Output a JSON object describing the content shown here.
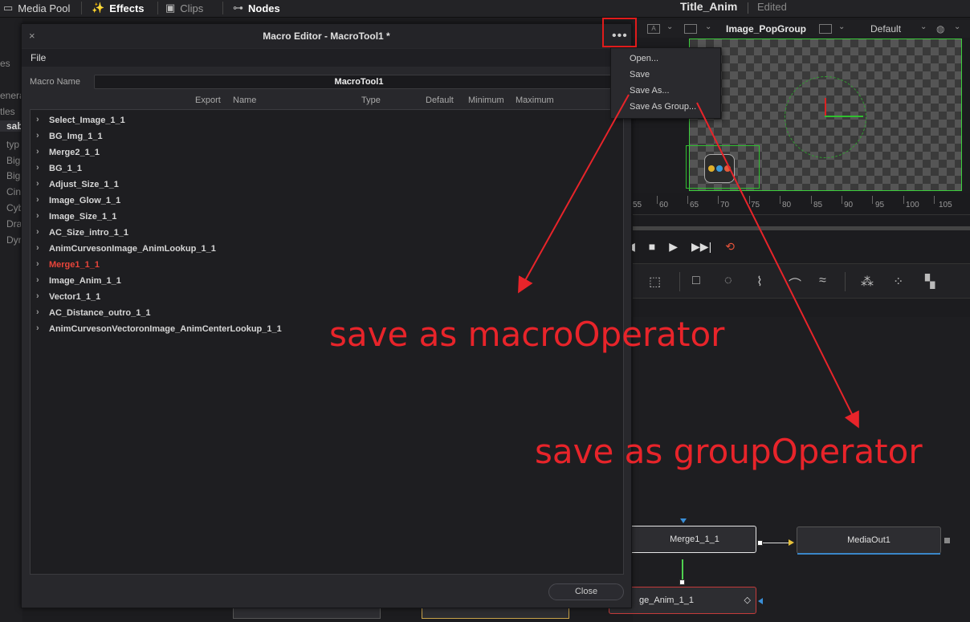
{
  "topbar": {
    "items": [
      {
        "label": "Media Pool",
        "icon": "media-pool-icon",
        "glyph": "▭"
      },
      {
        "label": "Effects",
        "icon": "effects-wand-icon",
        "glyph": "✨"
      },
      {
        "label": "Clips",
        "icon": "clips-icon",
        "glyph": "▣"
      },
      {
        "label": "Nodes",
        "icon": "nodes-icon",
        "glyph": "⊶"
      }
    ],
    "project_title": "Title_Anim",
    "project_status": "Edited"
  },
  "left_panel": {
    "items": [
      "es",
      "enera",
      "tles",
      "sab",
      "typ",
      "Big",
      "Big",
      "Cin",
      "Cyb",
      "Dra",
      "Dyn"
    ],
    "selected_index": 3
  },
  "viewer": {
    "node_name": "Image_PopGroup",
    "zoom_preset": "Default",
    "box_a": "A"
  },
  "ruler": {
    "labels": [
      "55",
      "60",
      "65",
      "70",
      "75",
      "80",
      "85",
      "90",
      "95",
      "100",
      "105"
    ]
  },
  "transport": {
    "buttons": [
      {
        "name": "prev-frame-icon",
        "glyph": "◀"
      },
      {
        "name": "stop-icon",
        "glyph": "■"
      },
      {
        "name": "play-icon",
        "glyph": "▶"
      },
      {
        "name": "next-icon",
        "glyph": "▶▶|"
      },
      {
        "name": "loop-icon",
        "glyph": "⟲"
      }
    ]
  },
  "toolstrip": {
    "icons": [
      {
        "name": "transform-icon",
        "glyph": "⬚"
      },
      {
        "name": "rectangle-mask-icon",
        "glyph": "□"
      },
      {
        "name": "ellipse-mask-icon",
        "glyph": "◌"
      },
      {
        "name": "polygon-mask-icon",
        "glyph": "⌇"
      },
      {
        "name": "bspline-mask-icon",
        "glyph": "⌒"
      },
      {
        "name": "paint-icon",
        "glyph": "≈"
      },
      {
        "name": "particles-icon",
        "glyph": "⁂"
      },
      {
        "name": "tracker-icon",
        "glyph": "⁘"
      },
      {
        "name": "planar-icon",
        "glyph": "▚"
      }
    ]
  },
  "nodes": {
    "merge": "Merge1_1_1",
    "mediaout": "MediaOut1",
    "image_anim": "ge_Anim_1_1"
  },
  "macro_editor": {
    "title": "Macro Editor - MacroTool1 *",
    "close_x": "×",
    "more_dots": "•••",
    "menu_file": "File",
    "macro_name_label": "Macro Name",
    "macro_name_value": "MacroTool1",
    "columns": {
      "export": "Export",
      "name": "Name",
      "type": "Type",
      "default": "Default",
      "minimum": "Minimum",
      "maximum": "Maximum"
    },
    "tree_items": [
      {
        "label": "Select_Image_1_1",
        "highlight": false
      },
      {
        "label": "BG_Img_1_1",
        "highlight": false
      },
      {
        "label": "Merge2_1_1",
        "highlight": false
      },
      {
        "label": "BG_1_1",
        "highlight": false
      },
      {
        "label": "Adjust_Size_1_1",
        "highlight": false
      },
      {
        "label": "Image_Glow_1_1",
        "highlight": false
      },
      {
        "label": "Image_Size_1_1",
        "highlight": false
      },
      {
        "label": "AC_Size_intro_1_1",
        "highlight": false
      },
      {
        "label": "AnimCurvesonImage_AnimLookup_1_1",
        "highlight": false
      },
      {
        "label": "Merge1_1_1",
        "highlight": true
      },
      {
        "label": "Image_Anim_1_1",
        "highlight": false
      },
      {
        "label": "Vector1_1_1",
        "highlight": false
      },
      {
        "label": "AC_Distance_outro_1_1",
        "highlight": false
      },
      {
        "label": "AnimCurvesonVectoronImage_AnimCenterLookup_1_1",
        "highlight": false
      }
    ],
    "close_button": "Close",
    "highlight_color": "#e8443a"
  },
  "dropdown": {
    "items": [
      "Open...",
      "Save",
      "Save As...",
      "Save As Group..."
    ]
  },
  "annotations": {
    "macro": "save as macroOperator",
    "group": "save as groupOperator",
    "color": "#e8242a"
  }
}
